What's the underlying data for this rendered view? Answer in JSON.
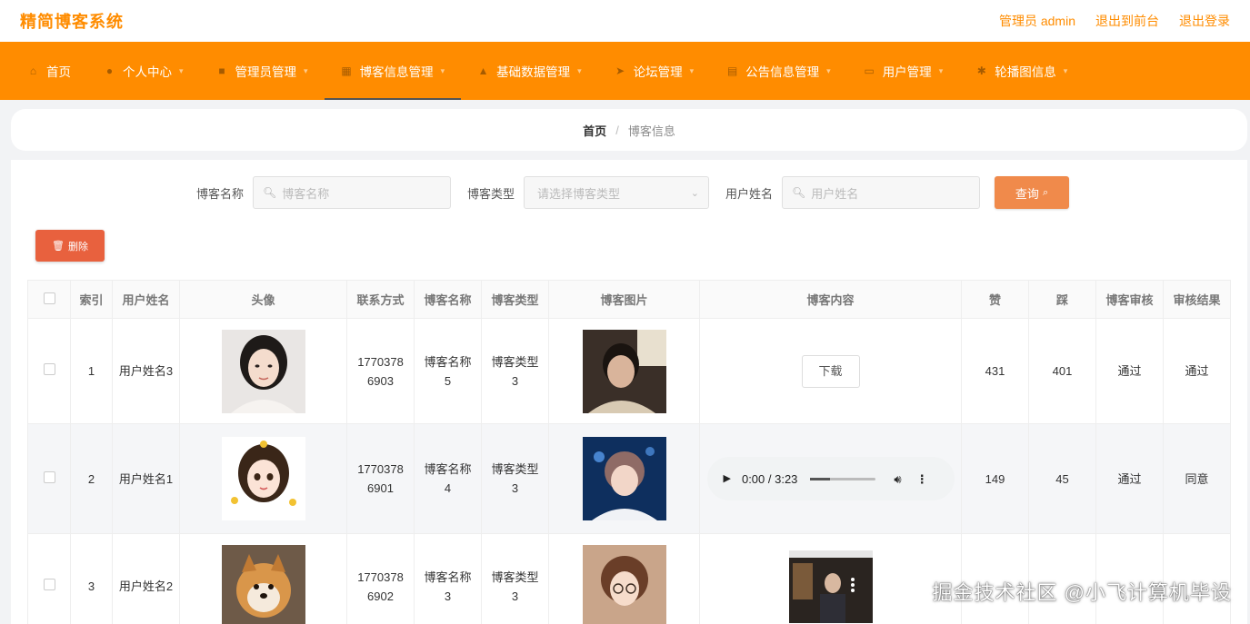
{
  "header": {
    "brand": "精简博客系统",
    "admin_label": "管理员 admin",
    "exit_front": "退出到前台",
    "logout": "退出登录"
  },
  "nav": [
    {
      "label": "首页",
      "icon": "home-icon"
    },
    {
      "label": "个人中心",
      "icon": "user-icon"
    },
    {
      "label": "管理员管理",
      "icon": "chat-icon"
    },
    {
      "label": "博客信息管理",
      "icon": "grid-icon"
    },
    {
      "label": "基础数据管理",
      "icon": "layers-icon"
    },
    {
      "label": "论坛管理",
      "icon": "send-icon"
    },
    {
      "label": "公告信息管理",
      "icon": "document-icon"
    },
    {
      "label": "用户管理",
      "icon": "id-card-icon"
    },
    {
      "label": "轮播图信息",
      "icon": "settings-icon"
    }
  ],
  "breadcrumb": {
    "home": "首页",
    "sep": "/",
    "current": "博客信息"
  },
  "search": {
    "name_label": "博客名称",
    "name_placeholder": "博客名称",
    "type_label": "博客类型",
    "type_placeholder": "请选择博客类型",
    "user_label": "用户姓名",
    "user_placeholder": "用户姓名",
    "query_label": "查询"
  },
  "delete_label": "删除",
  "table": {
    "columns": [
      "索引",
      "用户姓名",
      "头像",
      "联系方式",
      "博客名称",
      "博客类型",
      "博客图片",
      "博客内容",
      "赞",
      "踩",
      "博客审核",
      "审核结果"
    ],
    "rows": [
      {
        "index": "1",
        "user": "用户姓名3",
        "phone": "17703786903",
        "name": "博客名称5",
        "type": "博客类型3",
        "content_kind": "download",
        "content_label": "下载",
        "likes": "431",
        "dislikes": "401",
        "review": "通过",
        "result": "通过"
      },
      {
        "index": "2",
        "user": "用户姓名1",
        "phone": "17703786901",
        "name": "博客名称4",
        "type": "博客类型3",
        "content_kind": "audio",
        "content_label": "0:00 / 3:23",
        "likes": "149",
        "dislikes": "45",
        "review": "通过",
        "result": "同意"
      },
      {
        "index": "3",
        "user": "用户姓名2",
        "phone": "17703786902",
        "name": "博客名称3",
        "type": "博客类型3",
        "content_kind": "video",
        "content_label": "",
        "likes": "",
        "dislikes": "",
        "review": "",
        "result": ""
      }
    ]
  },
  "watermark": "掘金技术社区 @小飞计算机毕设"
}
